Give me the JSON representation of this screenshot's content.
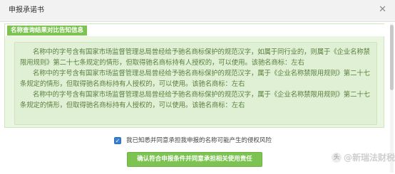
{
  "dialog": {
    "title": "申报承诺书",
    "close_glyph": "✕"
  },
  "panel": {
    "tag": "名称查询结果对比告知信息",
    "notices": [
      "名称中的字号含有国家市场监督管理总局曾经给予驰名商标保护的规范汉字，如属于同行业的，则属于《企业名称禁限用规则》第二十七条规定的情形，但取得驰名商标持有人授权的，可以使用。该驰名商标：左右",
      "名称中的字号含有国家市场监督管理总局曾经给予驰名商标保护的规范汉字，属于《企业名称禁限用规则》第二十七条规定的情形，但取得驰名商标持有人授权的，可以使用。该驰名商标：左右",
      "名称中的字号含有国家市场监督管理总局曾经给予驰名商标保护的规范汉字，属于《企业名称禁限用规则》第二十七条规定的情形，但取得驰名商标持有人授权的，可以使用。该驰名商标：左右"
    ]
  },
  "agreement": {
    "checked": true,
    "check_glyph": "✓",
    "label": "我已知悉并同意承担我申报的名称可能产生的侵权风险"
  },
  "confirm_button": "确认符合申报条件并同意承担相关使用责任",
  "watermark": {
    "icon_glyph": "头",
    "text": "@新瑞法财税"
  },
  "colors": {
    "accent_green": "#7cc352",
    "panel_bg": "#eaf6e0",
    "notice_text": "#5b7f3e",
    "checkbox_blue": "#3a7fd0"
  }
}
